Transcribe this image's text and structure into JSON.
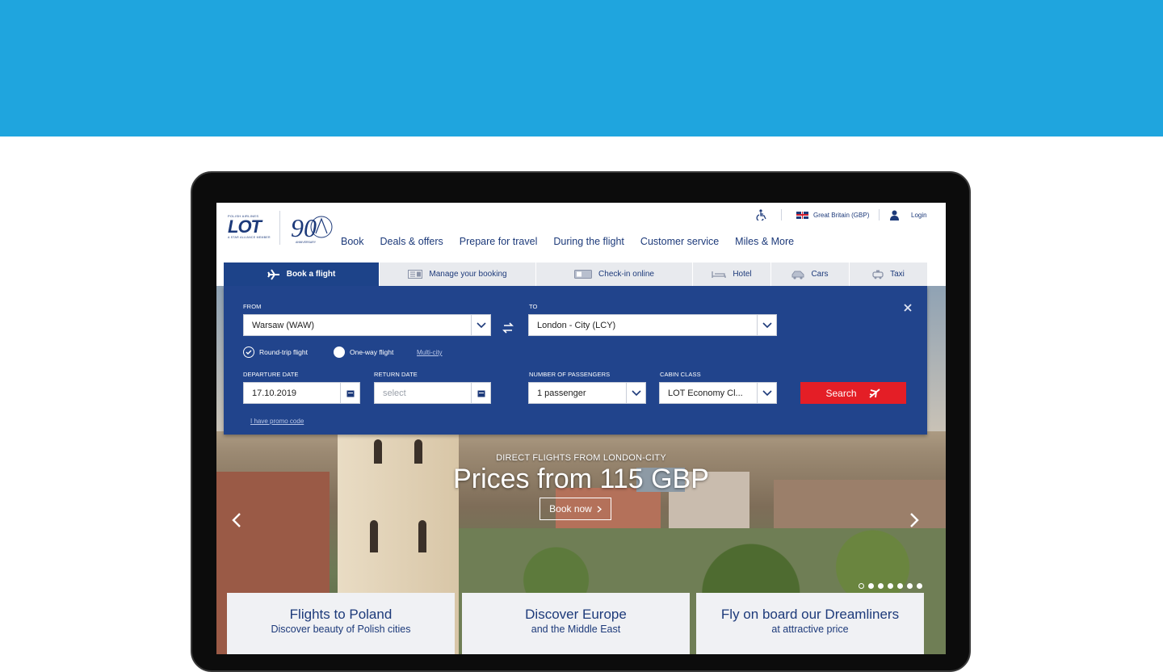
{
  "brand": {
    "logo_small": "POLISH AIRLINES",
    "logo_text": "LOT",
    "logo_member": "A STAR ALLIANCE MEMBER",
    "anniversary_number": "90",
    "anniversary_label": "ANNIVERSARY"
  },
  "utility": {
    "region": "Great Britain (GBP)",
    "login": "Login"
  },
  "nav": [
    "Book",
    "Deals & offers",
    "Prepare for travel",
    "During the flight",
    "Customer service",
    "Miles & More"
  ],
  "tabs": [
    {
      "label": "Book a flight",
      "icon": "plane-icon"
    },
    {
      "label": "Manage your booking",
      "icon": "ticket-icon"
    },
    {
      "label": "Check-in online",
      "icon": "boarding-pass-icon"
    },
    {
      "label": "Hotel",
      "icon": "bed-icon"
    },
    {
      "label": "Cars",
      "icon": "car-icon"
    },
    {
      "label": "Taxi",
      "icon": "taxi-icon"
    }
  ],
  "booking": {
    "from_label": "FROM",
    "from_value": "Warsaw (WAW)",
    "to_label": "TO",
    "to_value": "London - City (LCY)",
    "trip_roundtrip": "Round-trip flight",
    "trip_oneway": "One-way flight",
    "trip_multicity": "Multi-city",
    "departure_label": "DEPARTURE DATE",
    "departure_value": "17.10.2019",
    "return_label": "RETURN DATE",
    "return_placeholder": "select",
    "passengers_label": "NUMBER OF PASSENGERS",
    "passengers_value": "1 passenger",
    "cabin_label": "CABIN CLASS",
    "cabin_value": "LOT Economy Cl...",
    "search_label": "Search",
    "promo_link": "I have promo code"
  },
  "hero": {
    "subtitle": "DIRECT FLIGHTS FROM LONDON-CITY",
    "title": "Prices from 115 GBP",
    "cta": "Book now",
    "slide_count": 7,
    "active_slide": 1
  },
  "cards": [
    {
      "title": "Flights to Poland",
      "subtitle": "Discover beauty of Polish cities"
    },
    {
      "title": "Discover Europe",
      "subtitle": "and the Middle East"
    },
    {
      "title": "Fly on board our Dreamliners",
      "subtitle": "at attractive price"
    }
  ],
  "colors": {
    "band": "#1fa5de",
    "navy": "#21448c",
    "search_red": "#e41e26",
    "text_navy": "#1d3a7a"
  }
}
